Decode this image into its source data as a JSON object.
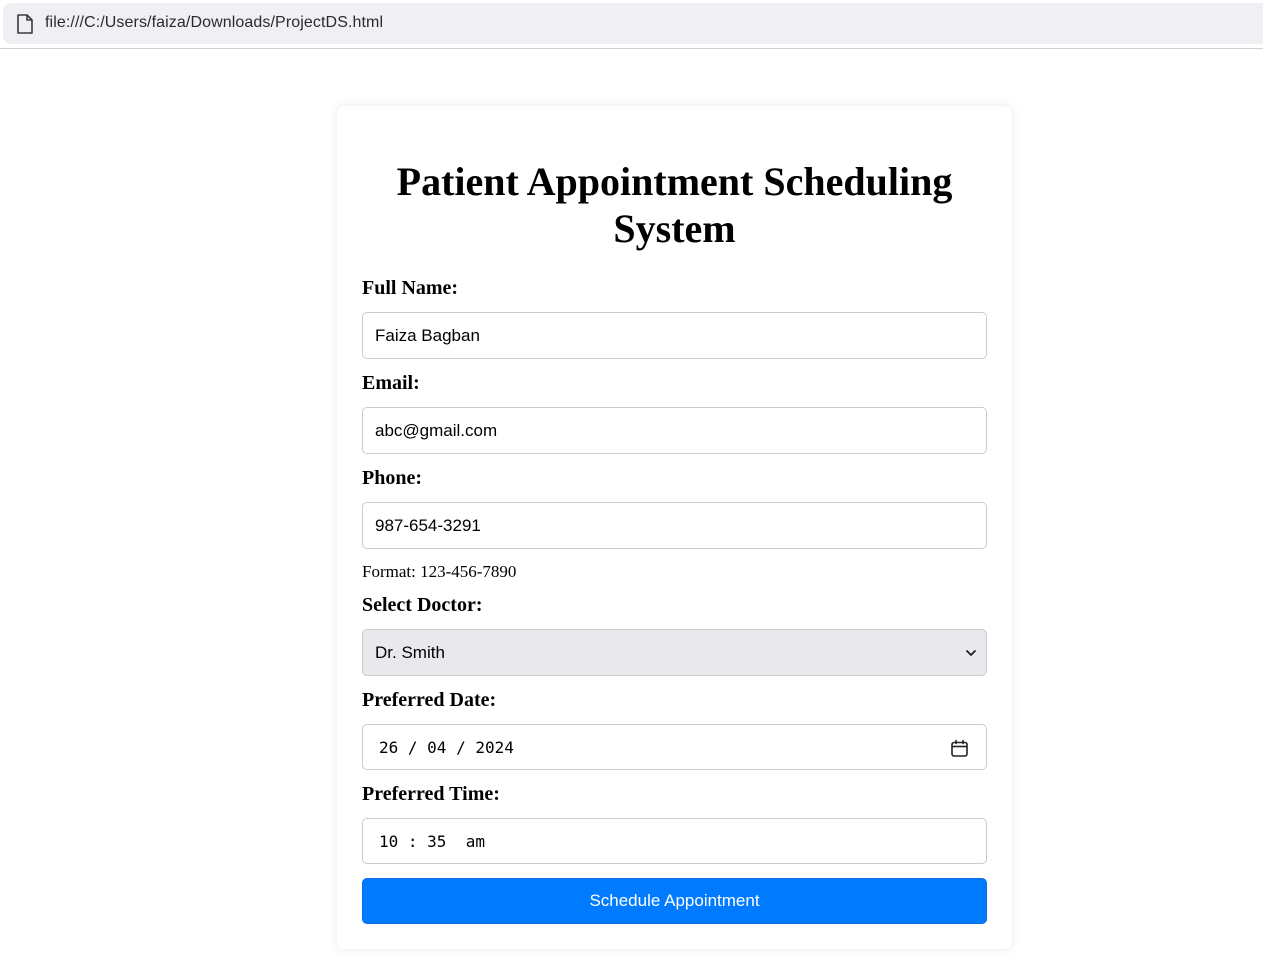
{
  "browser": {
    "url": "file:///C:/Users/faiza/Downloads/ProjectDS.html"
  },
  "form": {
    "title": "Patient Appointment Scheduling System",
    "full_name": {
      "label": "Full Name:",
      "value": "Faiza Bagban"
    },
    "email": {
      "label": "Email:",
      "value": "abc@gmail.com"
    },
    "phone": {
      "label": "Phone:",
      "value": "987-654-3291",
      "hint": "Format: 123-456-7890"
    },
    "doctor": {
      "label": "Select Doctor:",
      "selected": "Dr. Smith"
    },
    "date": {
      "label": "Preferred Date:",
      "value": "26 / 04 / 2024"
    },
    "time": {
      "label": "Preferred Time:",
      "value": "10 : 35  am"
    },
    "submit_label": "Schedule Appointment"
  },
  "icons": {
    "page": "page-icon",
    "dropdown": "chevron-down-icon",
    "calendar": "calendar-icon"
  },
  "colors": {
    "button": "#007bff",
    "select_bg": "#e9e9ed"
  }
}
